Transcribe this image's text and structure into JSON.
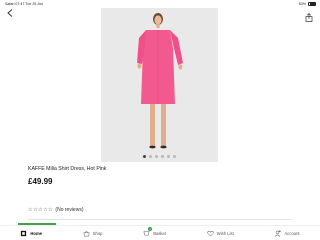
{
  "status_bar": {
    "left": "Safari  07:47  Tue 25 Jun",
    "battery": "83%"
  },
  "product": {
    "title": "KAFFE Milia Shirt Dress, Hot Pink",
    "price": "£49.99",
    "image_count": 6,
    "active_image_index": 0,
    "dress_color": "#f25a8f"
  },
  "rating": {
    "stars": "☆☆☆☆☆",
    "text": "(No reviews)"
  },
  "tabs": [
    {
      "label": "Home",
      "icon": "home-icon",
      "active": true
    },
    {
      "label": "Shop",
      "icon": "shop-icon",
      "active": false
    },
    {
      "label": "Basket",
      "icon": "basket-icon",
      "active": false,
      "badge": "1"
    },
    {
      "label": "Wish List",
      "icon": "heart-icon",
      "active": false
    },
    {
      "label": "Account",
      "icon": "account-icon",
      "active": false
    }
  ],
  "colors": {
    "accent_green": "#3fa34d",
    "image_bg": "#e9e9ea"
  }
}
